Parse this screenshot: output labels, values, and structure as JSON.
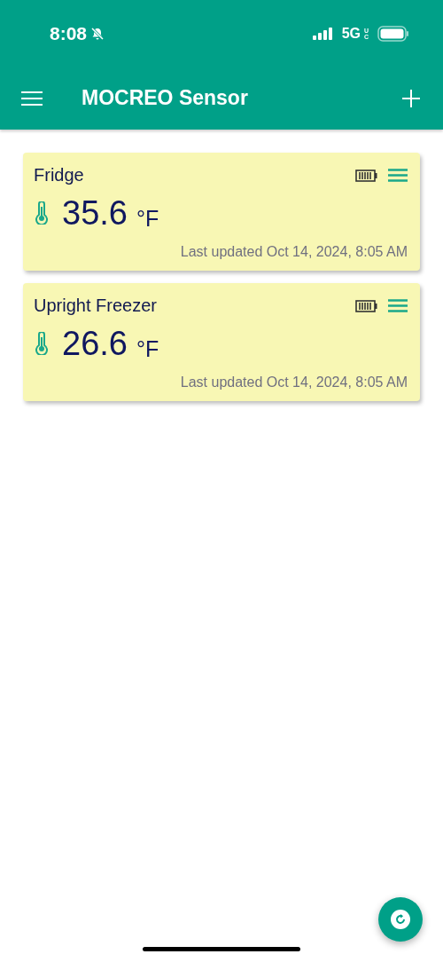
{
  "status_bar": {
    "time": "8:08",
    "network": "5G",
    "network_sub": "UC"
  },
  "app_bar": {
    "title": "MOCREO Sensor"
  },
  "sensors": [
    {
      "name": "Fridge",
      "value": "35.6",
      "unit": "°F",
      "updated": "Last updated Oct 14, 2024, 8:05 AM"
    },
    {
      "name": "Upright Freezer",
      "value": "26.6",
      "unit": "°F",
      "updated": "Last updated Oct 14, 2024, 8:05 AM"
    }
  ]
}
